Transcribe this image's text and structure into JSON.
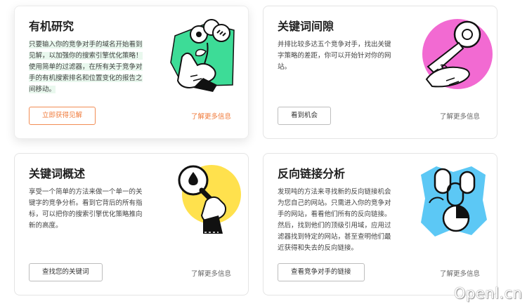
{
  "cards": [
    {
      "title": "有机研究",
      "desc": "只要输入你的竞争对手的域名开始看到见解，以加强你的搜索引擎优化策略！使用简单的过滤器，在所有关于竞争对手的有机搜索排名和位置变化的报告之间移动。",
      "button": "立即获得见解",
      "more": "了解更多信息",
      "illustration": "hand-holding-flower-icon",
      "accent": "#3ddc97"
    },
    {
      "title": "关键词间隙",
      "desc": "并排比较多达五个竞争对手，找出关键字策略的差距，你可以开始针对你的网站。",
      "button": "看到机会",
      "more": "了解更多信息",
      "illustration": "hand-with-key-icon",
      "accent": "#f26ad2"
    },
    {
      "title": "关键词概述",
      "desc": "享受一个简单的方法来做一个单一的关键字的竞争分析。看到它背后的所有指标，可以把你的搜索引擎优化策略推向新的高度。",
      "button": "查找您的关键词",
      "more": "了解更多信息",
      "illustration": "hand-with-magnifier-icon",
      "accent": "#ffe14d"
    },
    {
      "title": "反向链接分析",
      "desc": "发现吨的方法来寻找新的反向链接机会为您自己的网站。只需进入你的竞争对手的网站，看看他们所有的反向链接。然后，找到他们的顶级引用域，应用过滤器找到特定的网站，甚至查明他们最近获得和失去的反向链接。",
      "button": "查看竞争对手的链接",
      "more": "了解更多信息",
      "illustration": "chain-links-icon",
      "accent": "#5cc8f5"
    }
  ],
  "watermark": "Openl.cn",
  "colors": {
    "orange": "#f07a3a",
    "highlight": "#e9f8ee"
  }
}
